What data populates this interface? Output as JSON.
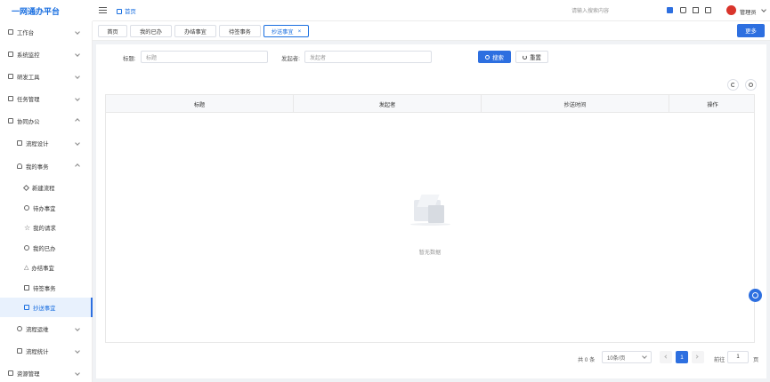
{
  "app": {
    "logo": "一网通办平台"
  },
  "topbar": {
    "breadcrumb_home": "首页",
    "search_placeholder": "请输入搜索内容",
    "user_name": "管理员"
  },
  "sidebar": {
    "items": [
      {
        "label": "工作台",
        "icon": "monitor-icon"
      },
      {
        "label": "系统监控",
        "icon": "monitor-icon"
      },
      {
        "label": "研发工具",
        "icon": "tools-icon"
      },
      {
        "label": "任务管理",
        "icon": "task-icon"
      },
      {
        "label": "协同办公",
        "icon": "cowork-icon"
      },
      {
        "label": "流程设计",
        "icon": "flow-icon"
      },
      {
        "label": "我的事务",
        "icon": "bell-icon"
      },
      {
        "label": "新建流程",
        "icon": "pen-icon"
      },
      {
        "label": "待办事宜",
        "icon": "clock-icon"
      },
      {
        "label": "我的请求",
        "icon": "star-icon"
      },
      {
        "label": "我的已办",
        "icon": "check-icon"
      },
      {
        "label": "办结事宜",
        "icon": "triangle-icon"
      },
      {
        "label": "待签事务",
        "icon": "sign-icon"
      },
      {
        "label": "抄送事宜",
        "icon": "send-icon"
      },
      {
        "label": "流程运维",
        "icon": "cloud-icon"
      },
      {
        "label": "流程统计",
        "icon": "chart-icon"
      },
      {
        "label": "资源管理",
        "icon": "folder-icon"
      }
    ]
  },
  "tags": [
    {
      "label": "首页"
    },
    {
      "label": "我的已办"
    },
    {
      "label": "办结事宜"
    },
    {
      "label": "待签事务"
    },
    {
      "label": "抄送事宜",
      "close": "×"
    }
  ],
  "more_button": "更多",
  "search": {
    "title_label": "标题:",
    "title_placeholder": "标题",
    "sender_label": "发起者:",
    "sender_placeholder": "发起者",
    "search_button": "搜索",
    "reset_button": "重置"
  },
  "table": {
    "columns": [
      "标题",
      "发起者",
      "抄送时间",
      "操作"
    ],
    "empty_text": "暂无数据"
  },
  "pagination": {
    "total": "共 0 条",
    "page_size": "10条/页",
    "current_page": "1",
    "goto_prefix": "前往",
    "goto_value": "1",
    "goto_suffix": "页"
  }
}
